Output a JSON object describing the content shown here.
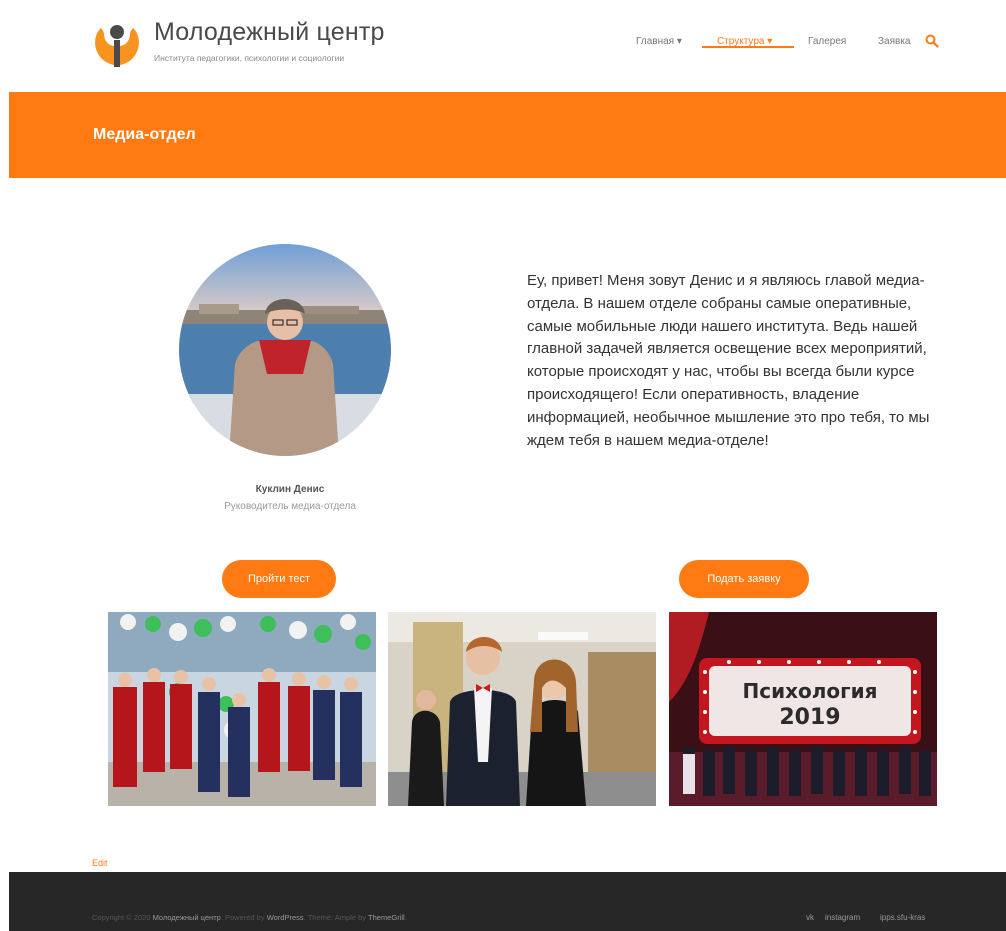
{
  "header": {
    "site_title": "Молодежный центр",
    "site_description": "Института педагогики, психологии и социологии",
    "logo_icon": "logo-icon",
    "nav": [
      {
        "label": "Главная",
        "has_dropdown": true,
        "active": false
      },
      {
        "label": "Структура",
        "has_dropdown": true,
        "active": true
      },
      {
        "label": "Галерея",
        "has_dropdown": false,
        "active": false
      },
      {
        "label": "Заявка",
        "has_dropdown": false,
        "active": false
      }
    ],
    "dropdown_arrow": "▾",
    "search_icon": "search-icon"
  },
  "banner": {
    "title": "Медиа-отдел"
  },
  "profile": {
    "name": "Куклин Денис",
    "role": "Руководитель медиа-отдела",
    "text": "Еу, привет! Меня зовут Денис и я являюсь главой медиа-отдела. В нашем отделе собраны самые оперативные, самые мобильные люди нашего института. Ведь нашей главной задачей является освещение всех мероприятий, которые происходят у нас, чтобы вы всегда были курсе происходящего! Если оперативность, владение информацией, необычное мышление это про тебя, то мы ждем тебя в нашем медиа-отделе!"
  },
  "buttons": {
    "test": "Пройти тест",
    "apply": "Подать заявку"
  },
  "gallery": {
    "photo3_sign_line1": "Психология",
    "photo3_sign_line2": "2019"
  },
  "edit_link": "Edit",
  "footer": {
    "copyright_prefix": "Copyright © 2020",
    "site_link": "Молодежный центр",
    "powered_by": ". Powered by",
    "wordpress": "WordPress",
    "theme_text": ". Theme: Ample by",
    "themegrill": "ThemeGrill",
    "period": ".",
    "social": [
      "vk",
      "instagram",
      "ipps.sfu-kras"
    ]
  },
  "colors": {
    "accent": "#ff7a12",
    "footer_bg": "#272727",
    "text": "#333333"
  }
}
